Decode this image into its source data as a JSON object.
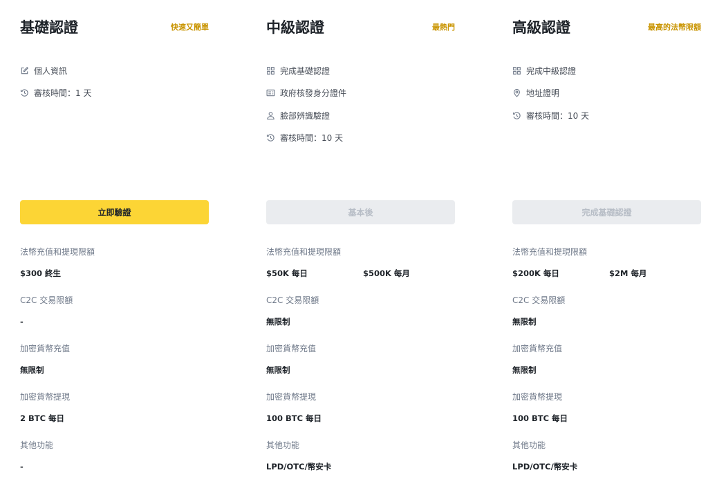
{
  "colors": {
    "accent": "#fcd535",
    "tag": "#c99400",
    "text_primary": "#1e2329",
    "text_secondary": "#707a8a",
    "disabled_bg": "#eaecef",
    "disabled_text": "#b7bdc6"
  },
  "limit_labels": {
    "fiat": "法幣充值和提現限額",
    "c2c": "C2C 交易限額",
    "crypto_deposit": "加密貨幣充值",
    "crypto_withdraw": "加密貨幣提現",
    "other": "其他功能"
  },
  "tiers": [
    {
      "title": "基礎認證",
      "tag": "快速又簡單",
      "requirements": [
        {
          "icon": "edit-icon",
          "text": "個人資訊"
        },
        {
          "icon": "clock-icon",
          "text": "審核時間：1 天"
        }
      ],
      "button": {
        "label": "立即驗證",
        "state": "primary"
      },
      "limits": {
        "fiat": [
          "$300 終生"
        ],
        "c2c": [
          "-"
        ],
        "crypto_deposit": [
          "無限制"
        ],
        "crypto_withdraw": [
          "2 BTC 每日"
        ],
        "other": [
          "-"
        ]
      }
    },
    {
      "title": "中級認證",
      "tag": "最熱門",
      "requirements": [
        {
          "icon": "grid-icon",
          "text": "完成基礎認證"
        },
        {
          "icon": "id-card-icon",
          "text": "政府核發身分證件"
        },
        {
          "icon": "person-icon",
          "text": "臉部辨識驗證"
        },
        {
          "icon": "clock-icon",
          "text": "審核時間：10 天"
        }
      ],
      "button": {
        "label": "基本後",
        "state": "disabled"
      },
      "limits": {
        "fiat": [
          "$50K 每日",
          "$500K 每月"
        ],
        "c2c": [
          "無限制"
        ],
        "crypto_deposit": [
          "無限制"
        ],
        "crypto_withdraw": [
          "100 BTC 每日"
        ],
        "other": [
          "LPD/OTC/幣安卡"
        ]
      }
    },
    {
      "title": "高級認證",
      "tag": "最高的法幣限額",
      "requirements": [
        {
          "icon": "grid-icon",
          "text": "完成中級認證"
        },
        {
          "icon": "location-pin-icon",
          "text": "地址證明"
        },
        {
          "icon": "clock-icon",
          "text": "審核時間：10 天"
        }
      ],
      "button": {
        "label": "完成基礎認證",
        "state": "disabled"
      },
      "limits": {
        "fiat": [
          "$200K 每日",
          "$2M 每月"
        ],
        "c2c": [
          "無限制"
        ],
        "crypto_deposit": [
          "無限制"
        ],
        "crypto_withdraw": [
          "100 BTC 每日"
        ],
        "other": [
          "LPD/OTC/幣安卡"
        ]
      }
    }
  ]
}
